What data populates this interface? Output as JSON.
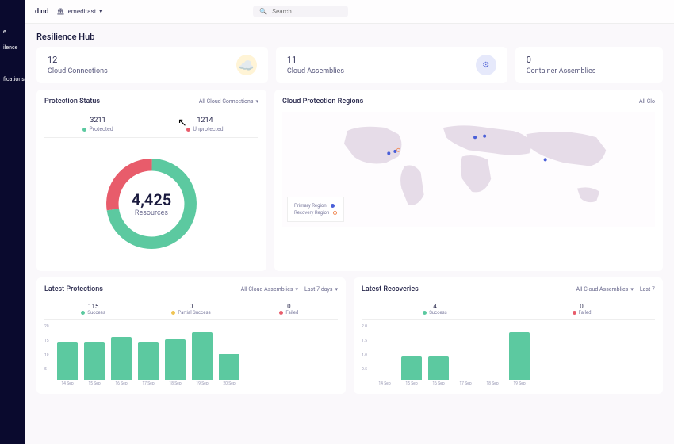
{
  "topbar": {
    "logo": "d\nnd",
    "org": "emeditast",
    "search_placeholder": "Search"
  },
  "sidebar": {
    "items": [
      "e",
      "ilence",
      "fications"
    ]
  },
  "page_title": "Resilience Hub",
  "stat_cards": [
    {
      "value": "12",
      "label": "Cloud Connections",
      "icon": "cloud"
    },
    {
      "value": "11",
      "label": "Cloud Assemblies",
      "icon": "gear"
    },
    {
      "value": "0",
      "label": "Container Assemblies",
      "icon": ""
    }
  ],
  "protection_status": {
    "title": "Protection Status",
    "filter": "All Cloud Connections",
    "items": [
      {
        "value": "3211",
        "label": "Protected",
        "color": "green"
      },
      {
        "value": "1214",
        "label": "Unprotected",
        "color": "red"
      }
    ],
    "total": "4,425",
    "total_label": "Resources"
  },
  "map": {
    "title": "Cloud Protection Regions",
    "filter": "All Clo",
    "legend": [
      {
        "label": "Primary Region",
        "color": "blue"
      },
      {
        "label": "Recovery Region",
        "color": "orange"
      }
    ]
  },
  "latest_protections": {
    "title": "Latest Protections",
    "filters": [
      "All Cloud Assemblies",
      "Last 7 days"
    ],
    "legend": [
      {
        "value": "115",
        "label": "Success",
        "color": "green"
      },
      {
        "value": "0",
        "label": "Partial Success",
        "color": "yellow"
      },
      {
        "value": "0",
        "label": "Failed",
        "color": "red"
      }
    ]
  },
  "latest_recoveries": {
    "title": "Latest Recoveries",
    "filters": [
      "All Cloud Assemblies",
      "Last 7"
    ],
    "legend": [
      {
        "value": "4",
        "label": "Success",
        "color": "green"
      },
      {
        "value": "0",
        "label": "Failed",
        "color": "red"
      }
    ]
  },
  "chart_data": [
    {
      "type": "bar",
      "title": "Latest Protections",
      "categories": [
        "14 Sep",
        "15 Sep",
        "16 Sep",
        "17 Sep",
        "18 Sep",
        "19 Sep",
        "20 Sep"
      ],
      "values": [
        16,
        16,
        18,
        16,
        17,
        20,
        11
      ],
      "ylim": [
        0,
        20
      ],
      "ylabel": "",
      "xlabel": ""
    },
    {
      "type": "bar",
      "title": "Latest Recoveries",
      "categories": [
        "14 Sep",
        "15 Sep",
        "16 Sep",
        "17 Sep",
        "18 Sep",
        "19 Sep"
      ],
      "values": [
        0,
        1,
        1,
        0,
        0,
        2
      ],
      "ylim": [
        0,
        2
      ],
      "ylabel": "",
      "xlabel": ""
    }
  ]
}
